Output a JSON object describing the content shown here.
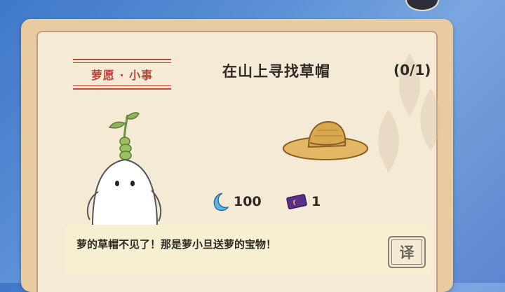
{
  "quest": {
    "tag": "萝愿 · 小事",
    "title": "在山上寻找草帽",
    "progress": "(0/1)"
  },
  "rewards": [
    {
      "icon": "moon-crystal-icon",
      "amount": "100"
    },
    {
      "icon": "ticket-icon",
      "amount": "1"
    }
  ],
  "dialog": {
    "text": "萝的草帽不见了！那是萝小旦送萝的宝物！",
    "translate_label": "译"
  },
  "colors": {
    "card_outer": "#e8cba0",
    "card_inner": "#f4ead6",
    "accent_red": "#c0493a",
    "text_dark": "#2f2a26"
  }
}
